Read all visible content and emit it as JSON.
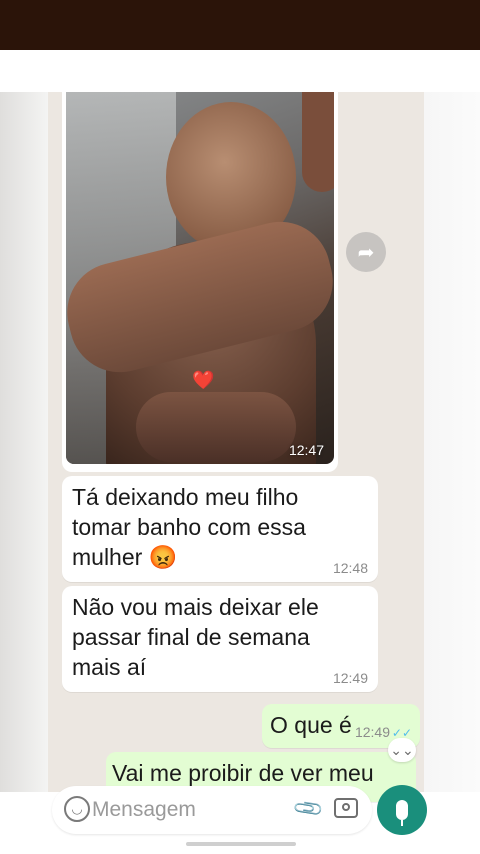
{
  "colors": {
    "status_bar": "#2b1409",
    "chat_background": "#ece7e1",
    "incoming_bubble": "#ffffff",
    "outgoing_bubble": "#e3fdd3",
    "send_button": "#1a8f7c",
    "read_ticks": "#53bdeb"
  },
  "media_message": {
    "time": "12:47",
    "heart": "❤️",
    "forward_icon": "forward-icon"
  },
  "messages": [
    {
      "direction": "incoming",
      "text": "Tá deixando meu filho tomar banho com essa mulher 😡",
      "time": "12:48"
    },
    {
      "direction": "incoming",
      "text": "Não vou mais deixar ele passar final de semana mais aí",
      "time": "12:49"
    },
    {
      "direction": "outgoing",
      "text": "O que é",
      "time": "12:49",
      "ticks": "✓✓"
    },
    {
      "direction": "outgoing",
      "text": "Vai me proibir de ver meu"
    }
  ],
  "composer": {
    "placeholder": "Mensagem",
    "emoji_icon": "emoji-icon",
    "attach_icon": "paperclip-icon",
    "camera_icon": "camera-icon",
    "mic_icon": "microphone-icon"
  }
}
